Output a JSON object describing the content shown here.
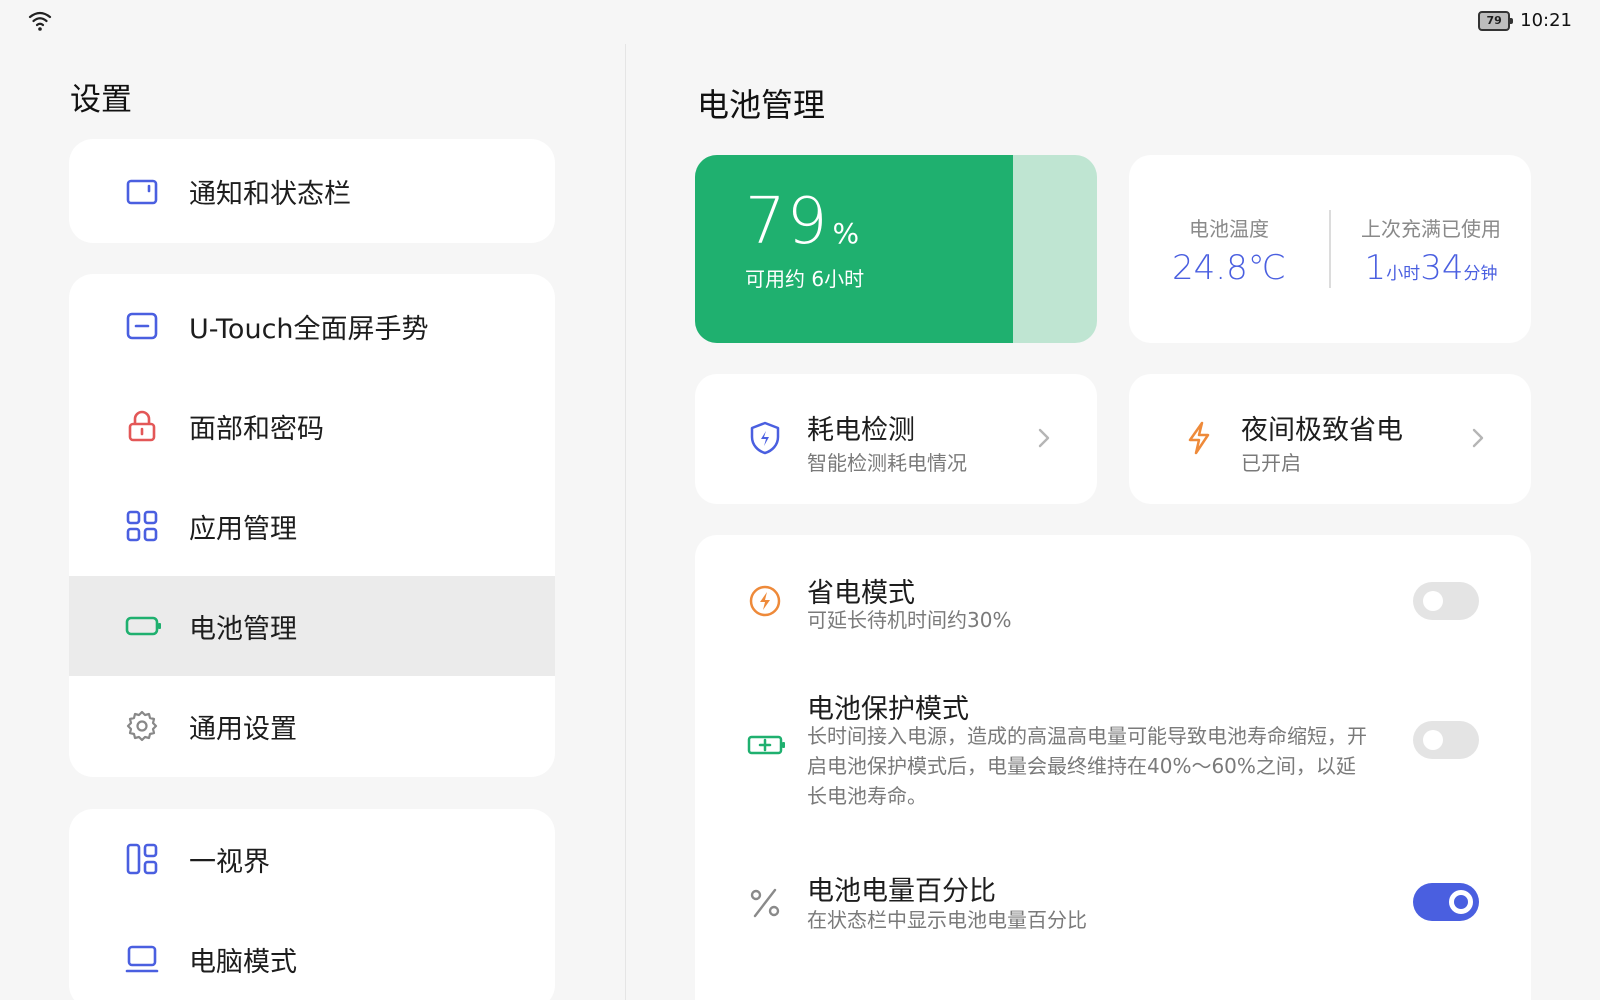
{
  "status_bar": {
    "battery_level": "79",
    "time": "10:21"
  },
  "sidebar": {
    "title": "设置",
    "items": [
      {
        "label": "通知和状态栏",
        "icon": "notification-icon"
      },
      {
        "label": "U-Touch全面屏手势",
        "icon": "gesture-icon"
      },
      {
        "label": "面部和密码",
        "icon": "lock-icon"
      },
      {
        "label": "应用管理",
        "icon": "apps-grid-icon"
      },
      {
        "label": "电池管理",
        "icon": "battery-icon",
        "selected": true
      },
      {
        "label": "通用设置",
        "icon": "gear-icon"
      },
      {
        "label": "一视界",
        "icon": "multi-window-icon"
      },
      {
        "label": "电脑模式",
        "icon": "laptop-icon"
      }
    ]
  },
  "main": {
    "title": "电池管理",
    "battery": {
      "level": "79",
      "unit": "%",
      "fill_fraction": 0.79,
      "remaining": "可用约 6小时"
    },
    "stats": {
      "temperature_label": "电池温度",
      "temperature_value": "24.8℃",
      "usage_label": "上次充满已使用",
      "usage_hours": "1",
      "usage_hours_unit": "小时",
      "usage_minutes": "34",
      "usage_minutes_unit": "分钟"
    },
    "tiles": [
      {
        "title": "耗电检测",
        "subtitle": "智能检测耗电情况",
        "icon": "shield-icon"
      },
      {
        "title": "夜间极致省电",
        "subtitle": "已开启",
        "icon": "lightning-icon"
      }
    ],
    "settings": [
      {
        "title": "省电模式",
        "subtitle": "可延长待机时间约30%",
        "icon": "power-save-icon",
        "enabled": false
      },
      {
        "title": "电池保护模式",
        "subtitle": "长时间接入电源，造成的高温高电量可能导致电池寿命缩短，开启电池保护模式后，电量会最终维持在40%～60%之间，以延长电池寿命。",
        "icon": "battery-charging-icon",
        "enabled": false
      },
      {
        "title": "电池电量百分比",
        "subtitle": "在状态栏中显示电池电量百分比",
        "icon": "percent-icon",
        "enabled": true
      }
    ]
  },
  "colors": {
    "accent": "#4a5fe0",
    "battery_green": "#1fb06f",
    "battery_track": "#bfe5d2",
    "icon_blue": "#4a5fe0",
    "icon_red": "#e35757",
    "icon_green": "#1fb06f",
    "icon_orange": "#ee8a3a"
  }
}
